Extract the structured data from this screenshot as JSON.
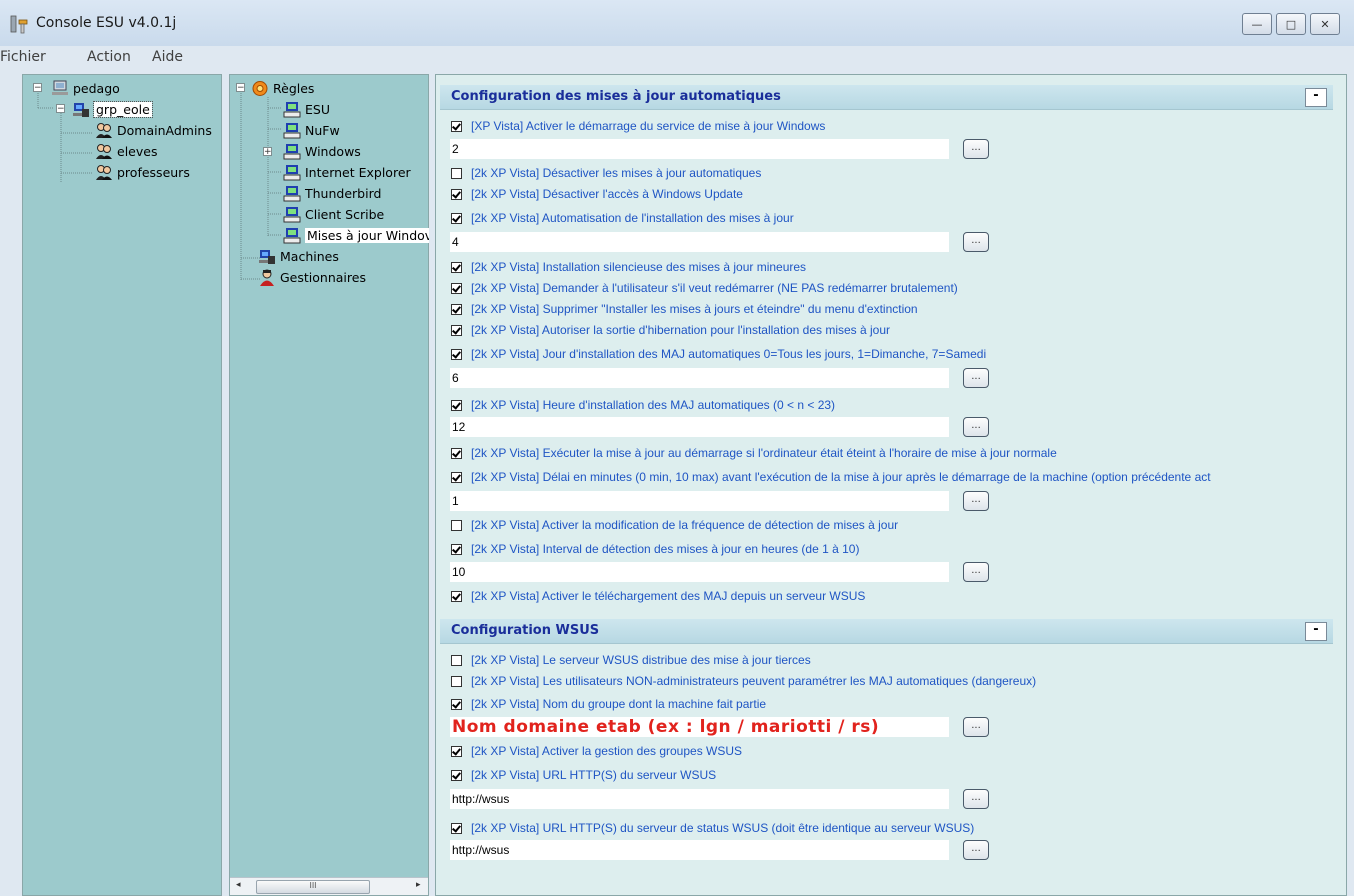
{
  "window": {
    "title": "Console ESU v4.0.1j",
    "minimize": "—",
    "maximize": "□",
    "close": "✕"
  },
  "menu": [
    "Fichier",
    "Action",
    "Aide"
  ],
  "tree1": {
    "root": "pedago",
    "group": "grp_eole",
    "children": [
      "DomainAdmins",
      "eleves",
      "professeurs"
    ]
  },
  "tree2": {
    "root": "Règles",
    "children": [
      "ESU",
      "NuFw",
      "Windows",
      "Internet Explorer",
      "Thunderbird",
      "Client Scribe",
      "Mises à jour Windov"
    ],
    "machines": "Machines",
    "gestionnaires": "Gestionnaires"
  },
  "scroll": {
    "left": "◂",
    "thumb": "III",
    "right": "▸"
  },
  "section1": {
    "title": "Configuration des mises à jour automatiques",
    "collapse": "-",
    "items": [
      {
        "label": "[XP Vista] Activer le démarrage du service de mise à jour Windows",
        "checked": true,
        "value": "2"
      },
      {
        "label": "[2k XP Vista] Désactiver les mises à jour automatiques",
        "checked": false
      },
      {
        "label": "[2k XP Vista] Désactiver l'accès à Windows Update",
        "checked": true
      },
      {
        "label": "[2k XP Vista] Automatisation de l'installation des mises à jour",
        "checked": true,
        "value": "4"
      },
      {
        "label": "[2k XP Vista] Installation silencieuse des mises à jour mineures",
        "checked": true
      },
      {
        "label": "[2k XP Vista] Demander à l'utilisateur s'il veut redémarrer (NE PAS redémarrer brutalement)",
        "checked": true
      },
      {
        "label": "[2k XP Vista] Supprimer \"Installer les mises à jours et éteindre\" du menu d'extinction",
        "checked": true
      },
      {
        "label": "[2k XP Vista] Autoriser la sortie d'hibernation pour l'installation des mises à jour",
        "checked": true
      },
      {
        "label": "[2k XP Vista] Jour d'installation des MAJ automatiques 0=Tous les jours, 1=Dimanche, 7=Samedi",
        "checked": true,
        "value": "6"
      },
      {
        "label": "[2k XP Vista] Heure d'installation des MAJ automatiques (0 < n < 23)",
        "checked": true,
        "value": "12"
      },
      {
        "label": "[2k XP Vista] Exécuter la mise à jour au démarrage si l'ordinateur était éteint à l'horaire de mise à jour normale",
        "checked": true
      },
      {
        "label": "[2k XP Vista] Délai en minutes (0 min, 10 max) avant l'exécution de la mise à jour après le démarrage de la machine (option précédente act",
        "checked": true,
        "value": "1"
      },
      {
        "label": "[2k XP Vista] Activer la modification de la fréquence de détection de mises à jour",
        "checked": false
      },
      {
        "label": "[2k XP Vista] Interval de détection des mises à jour en heures (de 1 à 10)",
        "checked": true,
        "value": "10"
      },
      {
        "label": "[2k XP Vista] Activer le téléchargement des MAJ depuis un serveur WSUS",
        "checked": true
      }
    ]
  },
  "section2": {
    "title": "Configuration WSUS",
    "collapse": "-",
    "items": [
      {
        "label": "[2k XP Vista] Le serveur WSUS distribue des mise à jour tierces",
        "checked": false
      },
      {
        "label": "[2k XP Vista] Les utilisateurs NON-administrateurs peuvent paramétrer les MAJ automatiques (dangereux)",
        "checked": false
      },
      {
        "label": "[2k XP Vista] Nom du groupe dont la machine fait partie",
        "checked": true,
        "value": "Nom domaine etab (ex : lgn / mariotti / rs)"
      },
      {
        "label": "[2k XP Vista] Activer la gestion des groupes WSUS",
        "checked": true
      },
      {
        "label": "[2k XP Vista] URL HTTP(S) du serveur WSUS",
        "checked": true,
        "value": "http://wsus"
      },
      {
        "label": "[2k XP Vista] URL HTTP(S) du serveur de status WSUS (doit être identique au serveur WSUS)",
        "checked": true,
        "value": "http://wsus"
      }
    ]
  },
  "button_label": "..."
}
